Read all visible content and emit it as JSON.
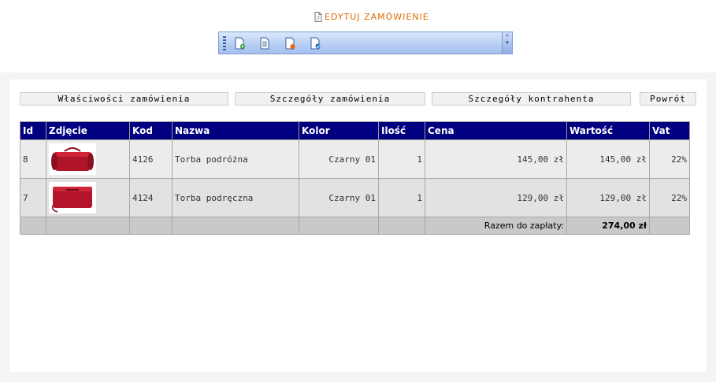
{
  "header": {
    "edit_title": "EDYTUJ ZAMÓWIENIE"
  },
  "toolbar": {
    "buttons": [
      {
        "icon": "new-document-icon"
      },
      {
        "icon": "document-list-icon"
      },
      {
        "icon": "delete-document-icon"
      },
      {
        "icon": "save-document-icon"
      }
    ]
  },
  "nav": {
    "properties": "Właściwości zamówienia",
    "details": "Szczegóły zamówienia",
    "contractor": "Szczegóły kontrahenta",
    "back": "Powrót"
  },
  "table": {
    "headers": [
      "Id",
      "Zdjęcie",
      "Kod",
      "Nazwa",
      "Kolor",
      "Ilość",
      "Cena",
      "Wartość",
      "Vat"
    ],
    "rows": [
      {
        "id": "8",
        "image": "red-travel-bag",
        "code": "4126",
        "name": "Torba podróżna",
        "color": "Czarny 01",
        "qty": "1",
        "price": "145,00 zł",
        "value": "145,00 zł",
        "vat": "22%"
      },
      {
        "id": "7",
        "image": "red-hand-bag",
        "code": "4124",
        "name": "Torba podręczna",
        "color": "Czarny 01",
        "qty": "1",
        "price": "129,00 zł",
        "value": "129,00 zł",
        "vat": "22%"
      }
    ],
    "total_label": "Razem do zapłaty:",
    "total_value": "274,00 zł"
  },
  "colors": {
    "header_bg": "#000080",
    "accent": "#e06a00"
  }
}
